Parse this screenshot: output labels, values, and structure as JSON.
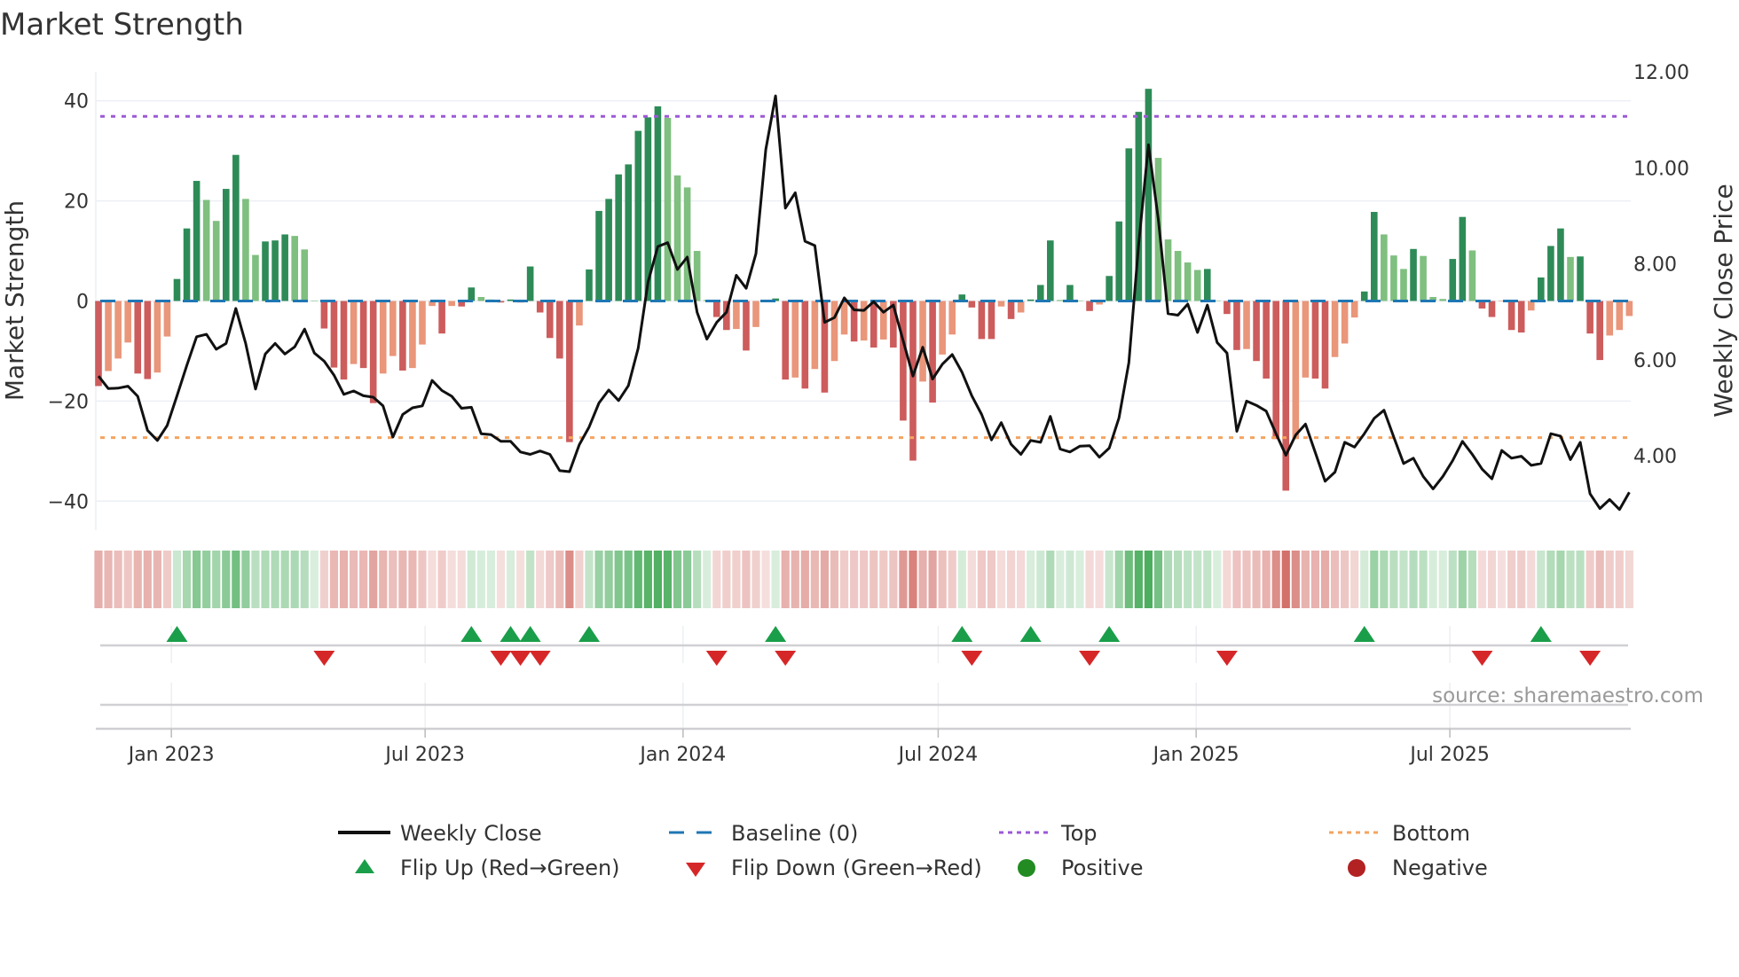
{
  "title": "Market Strength",
  "source": "source: sharemaestro.com",
  "colors": {
    "pos_rising": "#2e8b57",
    "pos_falling": "#7fbf7f",
    "neg_falling": "#cd5c5c",
    "neg_rising": "#e9967a",
    "baseline": "#1f77b4",
    "top": "#9b59d6",
    "bottom": "#f4a460",
    "flip_up": "#1a9e4a",
    "flip_down": "#d62728",
    "positive": "#228b22",
    "negative": "#b22222",
    "close": "#111111"
  },
  "chart_data": {
    "type": "bar",
    "title": "Market Strength",
    "ylabel": "Market Strength",
    "y2label": "Weekly Close Price",
    "ylim": [
      -45.8,
      45.8
    ],
    "y2lim": [
      2.45,
      12.0
    ],
    "frequency": "weekly",
    "start_date": "2022-11-10",
    "y_ticks": [
      {
        "v": 40,
        "label": "40"
      },
      {
        "v": 20,
        "label": "20"
      },
      {
        "v": 0,
        "label": "0"
      },
      {
        "v": -20,
        "label": "−20"
      },
      {
        "v": -40,
        "label": "−40"
      }
    ],
    "y2_ticks": [
      {
        "v": 12,
        "label": "12.00"
      },
      {
        "v": 10,
        "label": "10.00"
      },
      {
        "v": 8,
        "label": "8.00"
      },
      {
        "v": 6,
        "label": "6.00"
      },
      {
        "v": 4,
        "label": "4.00"
      }
    ],
    "x_ticks": [
      {
        "date": "2023-01-01",
        "label": "Jan 2023"
      },
      {
        "date": "2023-07-01",
        "label": "Jul 2023"
      },
      {
        "date": "2024-01-01",
        "label": "Jan 2024"
      },
      {
        "date": "2024-07-01",
        "label": "Jul 2024"
      },
      {
        "date": "2025-01-01",
        "label": "Jan 2025"
      },
      {
        "date": "2025-07-01",
        "label": "Jul 2025"
      }
    ],
    "top_level": 36.9,
    "bottom_level": -27.3,
    "baseline": 0,
    "strength": [
      -17,
      -14,
      -11.5,
      -8.3,
      -14.5,
      -15.6,
      -14.3,
      -7.1,
      4.4,
      14.5,
      24,
      20.2,
      16,
      22.4,
      29.2,
      20.4,
      9.2,
      11.9,
      12.1,
      13.3,
      13,
      10.3,
      0.1,
      -5.5,
      -13.3,
      -15.7,
      -12.6,
      -13.4,
      -20.4,
      -14.5,
      -11,
      -13.9,
      -13.4,
      -8.7,
      -1,
      -6.5,
      -1,
      -1.1,
      2.7,
      0.8,
      0.3,
      -0.3,
      0.3,
      -0.3,
      6.9,
      -2.3,
      -7.4,
      -11.5,
      -28.2,
      -4.9,
      6.3,
      18,
      20.4,
      25.3,
      27.3,
      34,
      36.7,
      38.9,
      36.6,
      25.1,
      22.7,
      10,
      0.2,
      -3.2,
      -5.8,
      -5.6,
      -9.9,
      -5.2,
      -0.2,
      0.5,
      -15.7,
      -15.3,
      -17.5,
      -13.6,
      -18.3,
      -12,
      -6.7,
      -8.1,
      -7.9,
      -9.3,
      -7.7,
      -9.3,
      -23.9,
      -31.9,
      -16.1,
      -20.3,
      -10.7,
      -6.7,
      1.3,
      -1.3,
      -7.6,
      -7.6,
      -1.1,
      -3.6,
      -2.3,
      0.3,
      3.2,
      12.1,
      0.2,
      3.2,
      0.1,
      -2,
      -0.7,
      5,
      15.9,
      30.5,
      37.8,
      42.4,
      28.6,
      12.3,
      10,
      7.7,
      6.2,
      6.4,
      0.1,
      -2.6,
      -9.8,
      -9.6,
      -12,
      -15.5,
      -27.6,
      -37.9,
      -27.6,
      -15.3,
      -15.5,
      -17.5,
      -11.2,
      -8.5,
      -3.3,
      1.9,
      17.8,
      13.3,
      9.1,
      6.4,
      10.4,
      9,
      0.8,
      0.4,
      8.4,
      16.8,
      10.1,
      -1.5,
      -3.2,
      -0.1,
      -5.8,
      -6.3,
      -1.9,
      4.7,
      11,
      14.5,
      8.8,
      8.9,
      -6.5,
      -11.8,
      -6.9,
      -5.8,
      -3
    ],
    "weekly_close": [
      5.66,
      5.4,
      5.41,
      5.45,
      5.24,
      4.53,
      4.32,
      4.63,
      5.25,
      5.88,
      6.48,
      6.53,
      6.22,
      6.34,
      7.07,
      6.34,
      5.39,
      6.12,
      6.34,
      6.12,
      6.27,
      6.64,
      6.14,
      5.97,
      5.68,
      5.28,
      5.35,
      5.25,
      5.22,
      5.04,
      4.39,
      4.86,
      5.0,
      5.04,
      5.57,
      5.36,
      5.24,
      4.99,
      5.01,
      4.46,
      4.44,
      4.3,
      4.3,
      4.08,
      4.03,
      4.1,
      4.03,
      3.69,
      3.67,
      4.23,
      4.6,
      5.1,
      5.37,
      5.15,
      5.46,
      6.24,
      7.62,
      8.36,
      8.44,
      7.88,
      8.14,
      6.99,
      6.43,
      6.78,
      6.99,
      7.76,
      7.49,
      8.21,
      10.38,
      11.5,
      9.16,
      9.48,
      8.47,
      8.38,
      6.78,
      6.88,
      7.29,
      7.04,
      7.03,
      7.21,
      6.99,
      7.14,
      6.4,
      5.66,
      6.26,
      5.6,
      5.91,
      6.11,
      5.74,
      5.25,
      4.86,
      4.33,
      4.69,
      4.24,
      4.03,
      4.32,
      4.28,
      4.82,
      4.14,
      4.08,
      4.2,
      4.21,
      3.97,
      4.16,
      4.79,
      5.94,
      8.41,
      10.48,
      8.93,
      6.96,
      6.93,
      7.16,
      6.57,
      7.14,
      6.36,
      6.14,
      4.51,
      5.14,
      5.05,
      4.93,
      4.46,
      4.01,
      4.43,
      4.66,
      4.07,
      3.47,
      3.66,
      4.28,
      4.18,
      4.46,
      4.78,
      4.95,
      4.39,
      3.84,
      3.95,
      3.57,
      3.31,
      3.57,
      3.9,
      4.3,
      4.03,
      3.72,
      3.52,
      4.11,
      3.95,
      3.99,
      3.8,
      3.84,
      4.46,
      4.41,
      3.92,
      4.28,
      3.21,
      2.9,
      3.09,
      2.88,
      3.24
    ],
    "flip_up_weeks": [
      8,
      38,
      42,
      44,
      50,
      69,
      88,
      95,
      103,
      129,
      147
    ],
    "flip_down_weeks": [
      23,
      41,
      43,
      45,
      63,
      70,
      89,
      101,
      115,
      141,
      152
    ],
    "legend": {
      "placement": "bottom",
      "items": [
        {
          "key": "close",
          "label": "Weekly Close"
        },
        {
          "key": "baseline",
          "label": "Baseline (0)"
        },
        {
          "key": "top",
          "label": "Top"
        },
        {
          "key": "bottom",
          "label": "Bottom"
        },
        {
          "key": "flip_up",
          "label": "Flip Up (Red→Green)"
        },
        {
          "key": "flip_down",
          "label": "Flip Down (Green→Red)"
        },
        {
          "key": "positive",
          "label": "Positive"
        },
        {
          "key": "negative",
          "label": "Negative"
        }
      ]
    }
  }
}
